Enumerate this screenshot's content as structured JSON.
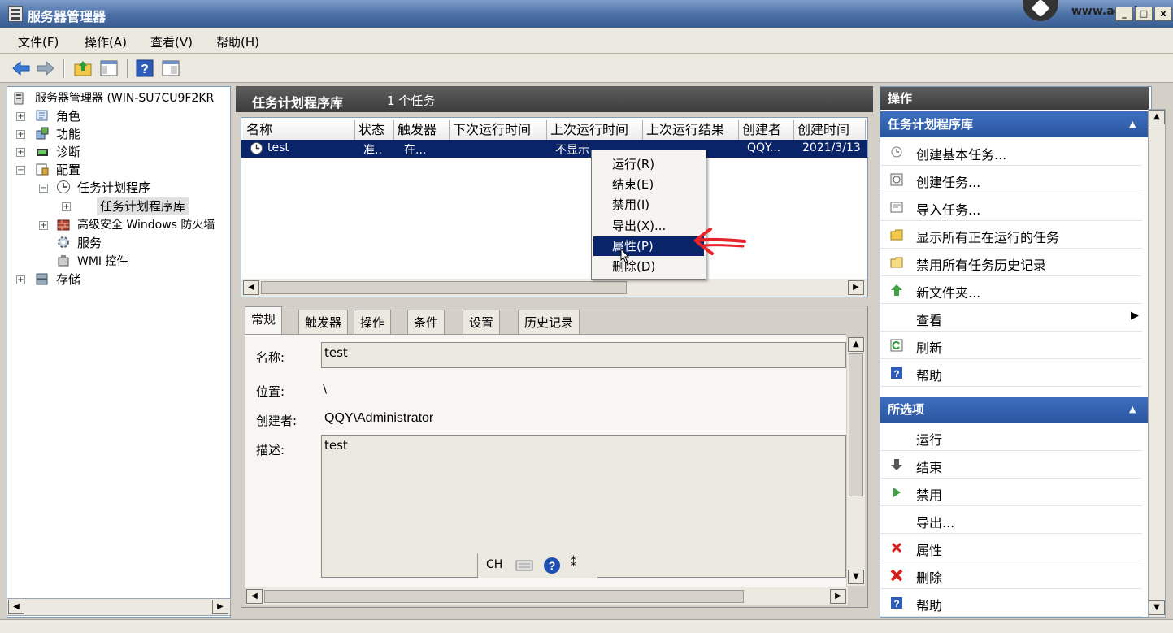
{
  "window": {
    "title": "服务器管理器",
    "watermark": "www.aomi"
  },
  "menubar": [
    "文件(F)",
    "操作(A)",
    "查看(V)",
    "帮助(H)"
  ],
  "tree": {
    "root": "服务器管理器 (WIN-SU7CU9F2KR",
    "items": [
      "角色",
      "功能",
      "诊断",
      "配置",
      "任务计划程序",
      "任务计划程序库",
      "高级安全 Windows 防火墙",
      "服务",
      "WMI 控件",
      "存储"
    ]
  },
  "center": {
    "header_title": "任务计划程序库",
    "header_count": "1 个任务",
    "columns": [
      "名称",
      "状态",
      "触发器",
      "下次运行时间",
      "上次运行时间",
      "上次运行结果",
      "创建者",
      "创建时间"
    ],
    "row": {
      "name": "test",
      "status": "准..",
      "trigger": "在...",
      "last_run": "不显示",
      "author": "QQY...",
      "created": "2021/3/13"
    }
  },
  "context_menu": [
    "运行(R)",
    "结束(E)",
    "禁用(I)",
    "导出(X)...",
    "属性(P)",
    "删除(D)"
  ],
  "details": {
    "tabs": [
      "常规",
      "触发器",
      "操作",
      "条件",
      "设置",
      "历史记录"
    ],
    "name_label": "名称:",
    "name_value": "test",
    "location_label": "位置:",
    "location_value": "\\",
    "author_label": "创建者:",
    "author_value": "QQY\\Administrator",
    "desc_label": "描述:",
    "desc_value": "test",
    "ime_lang": "CH"
  },
  "actions": {
    "header": "操作",
    "section1": "任务计划程序库",
    "items1": [
      "创建基本任务...",
      "创建任务...",
      "导入任务...",
      "显示所有正在运行的任务",
      "禁用所有任务历史记录",
      "新文件夹...",
      "查看",
      "刷新",
      "帮助"
    ],
    "section2": "所选项",
    "items2": [
      "运行",
      "结束",
      "禁用",
      "导出...",
      "属性",
      "删除",
      "帮助"
    ]
  },
  "colors": {
    "selection": "#0a246a",
    "section_header": "#2f5ea6",
    "annotation_arrow": "#e8232a"
  }
}
